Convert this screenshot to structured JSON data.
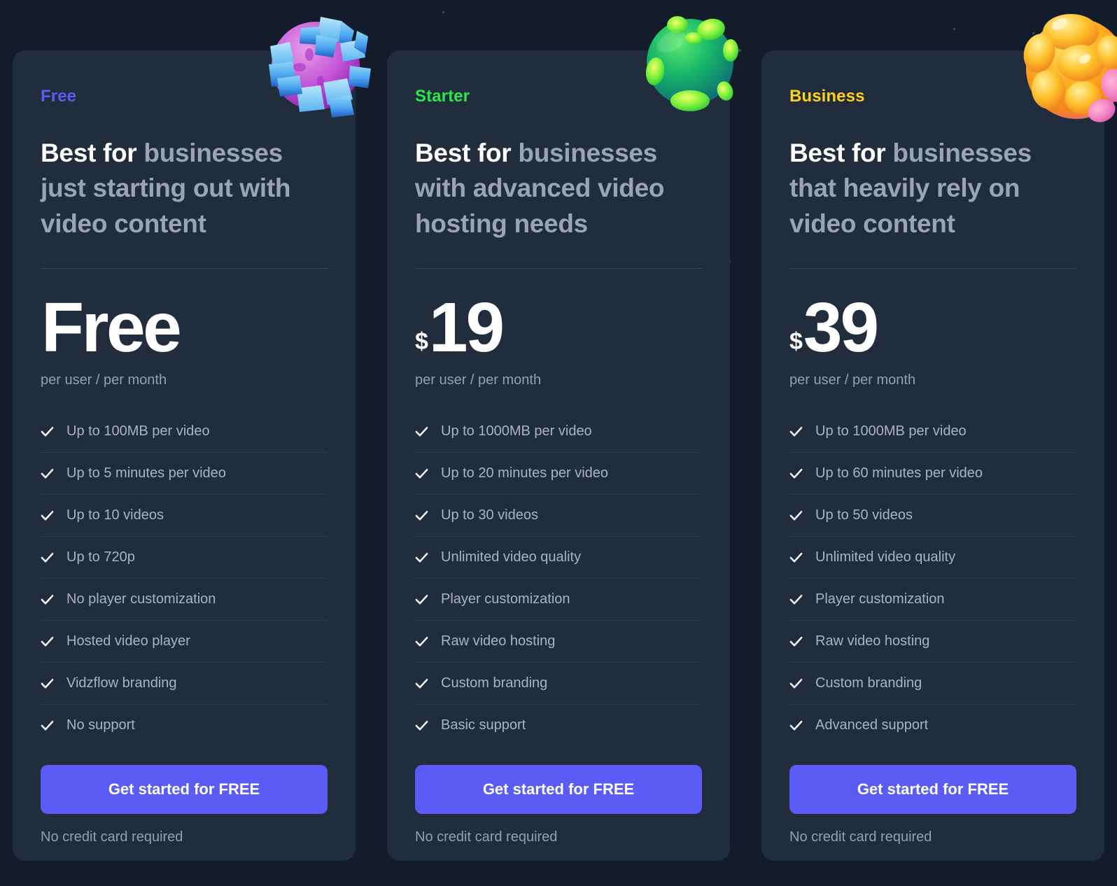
{
  "theme": {
    "page_background": "#131c2b",
    "card_background": "#212c3c",
    "cta_color": "#5b5bf5",
    "muted_text": "#93a0b0"
  },
  "plans": [
    {
      "name": "Free",
      "name_color": "#5b5bf5",
      "planet_icon": "purple-crystal-planet-icon",
      "tagline_highlight": "Best for ",
      "tagline_rest": "businesses just starting out with video content",
      "currency": "",
      "amount": "Free",
      "price_note": "per user / per month",
      "features": [
        "Up to 100MB per video",
        "Up to 5 minutes per video",
        "Up to 10 videos",
        "Up to 720p",
        "No player customization",
        "Hosted video player",
        "Vidzflow branding",
        "No support"
      ],
      "cta_label": "Get started for FREE",
      "cta_note": "No credit card required"
    },
    {
      "name": "Starter",
      "name_color": "#2ae84a",
      "planet_icon": "green-crater-planet-icon",
      "tagline_highlight": "Best for ",
      "tagline_rest": "businesses with advanced video hosting needs",
      "currency": "$",
      "amount": "19",
      "price_note": "per user / per month",
      "features": [
        "Up to 1000MB per video",
        "Up to 20 minutes per video",
        "Up to 30 videos",
        "Unlimited video quality",
        "Player customization",
        "Raw video hosting",
        "Custom branding",
        "Basic support"
      ],
      "cta_label": "Get started for FREE",
      "cta_note": "No credit card required"
    },
    {
      "name": "Business",
      "name_color": "#ffd11a",
      "planet_icon": "orange-bubble-planet-icon",
      "tagline_highlight": "Best for ",
      "tagline_rest": "businesses that heavily rely on video content",
      "currency": "$",
      "amount": "39",
      "price_note": "per user / per month",
      "features": [
        "Up to 1000MB per video",
        "Up to 60 minutes per video",
        "Up to 50 videos",
        "Unlimited video quality",
        "Player customization",
        "Raw video hosting",
        "Custom branding",
        "Advanced support"
      ],
      "cta_label": "Get started for FREE",
      "cta_note": "No credit card required"
    }
  ]
}
